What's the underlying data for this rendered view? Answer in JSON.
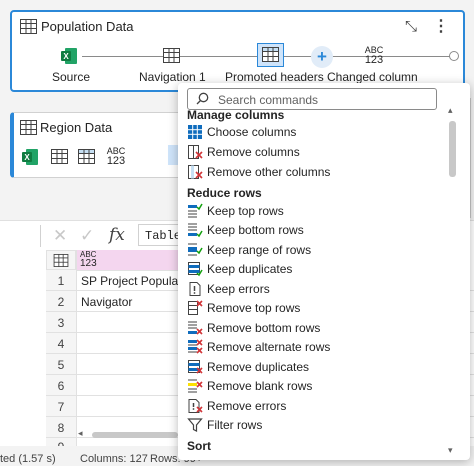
{
  "queries": {
    "population": {
      "title": "Population Data",
      "steps": [
        "Source",
        "Navigation 1",
        "Promoted headers",
        "Changed column"
      ],
      "type_badge": [
        "ABC",
        "123"
      ]
    },
    "region": {
      "title": "Region Data",
      "type_badge": [
        "ABC",
        "123"
      ]
    }
  },
  "formula_bar": {
    "fx_label": "fx",
    "formula": "Table"
  },
  "grid": {
    "column_type_badge": [
      "ABC",
      "123"
    ],
    "rows": [
      {
        "num": "1",
        "value": "SP Project Populatio"
      },
      {
        "num": "2",
        "value": "Navigator"
      },
      {
        "num": "3",
        "value": ""
      },
      {
        "num": "4",
        "value": ""
      },
      {
        "num": "5",
        "value": ""
      },
      {
        "num": "6",
        "value": ""
      },
      {
        "num": "7",
        "value": ""
      },
      {
        "num": "8",
        "value": ""
      },
      {
        "num": "9",
        "value": ""
      }
    ]
  },
  "status_bar": {
    "duration": "ted (1.57 s)",
    "columns": "Columns: 127",
    "rows": "Rows: 99+"
  },
  "menu": {
    "search_placeholder": "Search commands",
    "sections": {
      "manage": "Manage columns",
      "reduce": "Reduce rows",
      "sort": "Sort"
    },
    "manage_items": [
      "Choose columns",
      "Remove columns",
      "Remove other columns"
    ],
    "reduce_items": [
      "Keep top rows",
      "Keep bottom rows",
      "Keep range of rows",
      "Keep duplicates",
      "Keep errors",
      "Remove top rows",
      "Remove bottom rows",
      "Remove alternate rows",
      "Remove duplicates",
      "Remove blank rows",
      "Remove errors",
      "Filter rows"
    ]
  },
  "colors": {
    "accent": "#2b88d8",
    "excel_green": "#107c41",
    "remove_red": "#d13438",
    "keep_green": "#13a10e",
    "column_header_pink": "#f4d6ef"
  }
}
